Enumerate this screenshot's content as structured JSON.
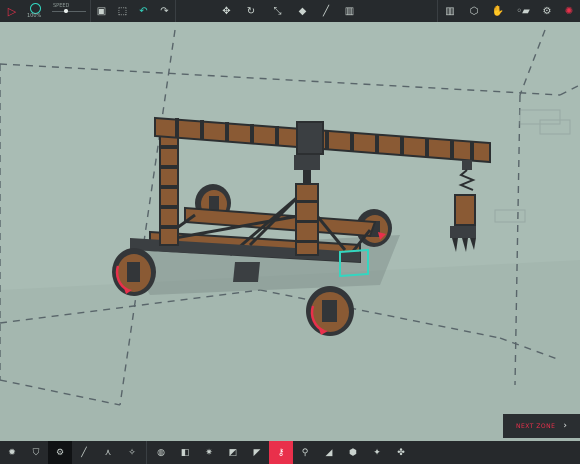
{
  "toolbar": {
    "play_icon": "play-icon",
    "simulation_speed": "100%",
    "timescale_label": "SPEED",
    "timescale_value": 0.4,
    "icons": {
      "save": "save-icon",
      "load": "load-icon",
      "undo": "undo-icon",
      "redo": "redo-icon",
      "translate": "move-icon",
      "rotate": "rotate-icon",
      "flip": "flip-icon",
      "paint": "paint-icon",
      "wand": "wand-icon",
      "delete": "trash-icon",
      "stats": "stats-icon",
      "cube": "cube-icon",
      "hand": "hand-icon",
      "toggle": "toggle-icon",
      "settings": "gear-icon",
      "alert": "alert-icon"
    }
  },
  "bottombar": {
    "categories": [
      "settings",
      "shield",
      "wrench",
      "pencil",
      "tree",
      "star"
    ],
    "selected_category": "gears",
    "selected_block_index": 5
  },
  "next_zone": {
    "label": "NEXT ZONE"
  },
  "colors": {
    "accent": "#e9304b",
    "teal": "#33d6c0",
    "ground": "#a9bcb4",
    "toolbar": "#262a2d"
  }
}
